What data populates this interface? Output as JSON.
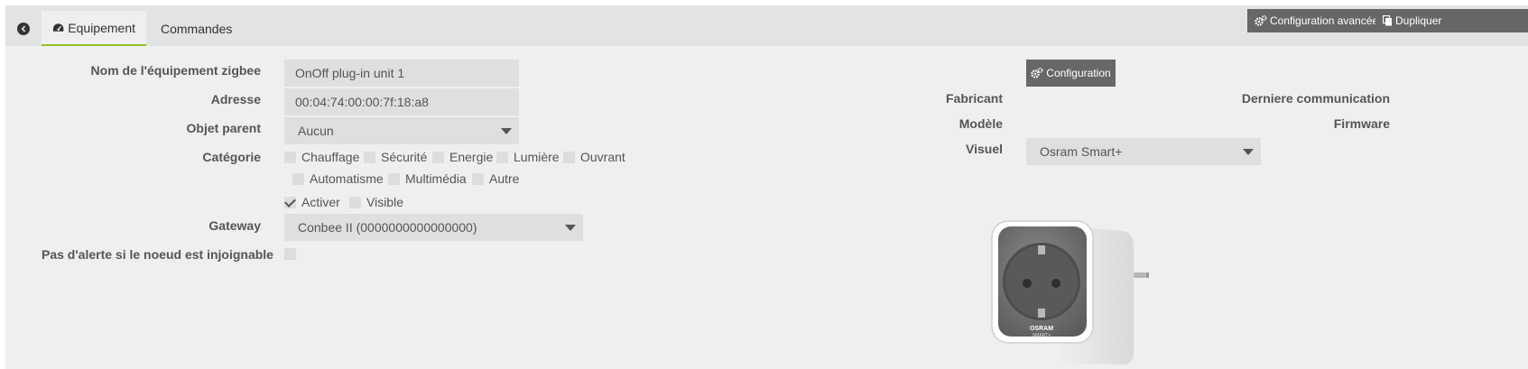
{
  "tabs": {
    "equipment": "Equipement",
    "commands": "Commandes"
  },
  "toolbar": {
    "advanced_config": "Configuration avancée",
    "duplicate": "Dupliquer"
  },
  "form": {
    "name_label": "Nom de l'équipement zigbee",
    "name_value": "OnOff plug-in unit 1",
    "address_label": "Adresse",
    "address_value": "00:04:74:00:00:7f:18:a8",
    "parent_label": "Objet parent",
    "parent_value": "Aucun",
    "category_label": "Catégorie",
    "categories": [
      {
        "label": "Chauffage",
        "checked": false
      },
      {
        "label": "Sécurité",
        "checked": false
      },
      {
        "label": "Energie",
        "checked": false
      },
      {
        "label": "Lumière",
        "checked": false
      },
      {
        "label": "Ouvrant",
        "checked": false
      },
      {
        "label": "Automatisme",
        "checked": false
      },
      {
        "label": "Multimédia",
        "checked": false
      },
      {
        "label": "Autre",
        "checked": false
      }
    ],
    "enable_label": "Activer",
    "enable_checked": true,
    "visible_label": "Visible",
    "visible_checked": false,
    "gateway_label": "Gateway",
    "gateway_value": "Conbee II (0000000000000000)",
    "no_alert_label": "Pas d'alerte si le noeud est injoignable",
    "no_alert_checked": false
  },
  "info": {
    "config_button": "Configuration",
    "manufacturer_label": "Fabricant",
    "model_label": "Modèle",
    "visual_label": "Visuel",
    "visual_value": "Osram Smart+",
    "last_comm_label": "Derniere communication",
    "firmware_label": "Firmware"
  },
  "product_image": {
    "brand": "OSRAM",
    "subbrand": "SMART+"
  },
  "colors": {
    "accent": "#94c11f",
    "button_dark": "#676767",
    "field_bg": "#dedfe0",
    "page_bg": "#eeeff0"
  }
}
